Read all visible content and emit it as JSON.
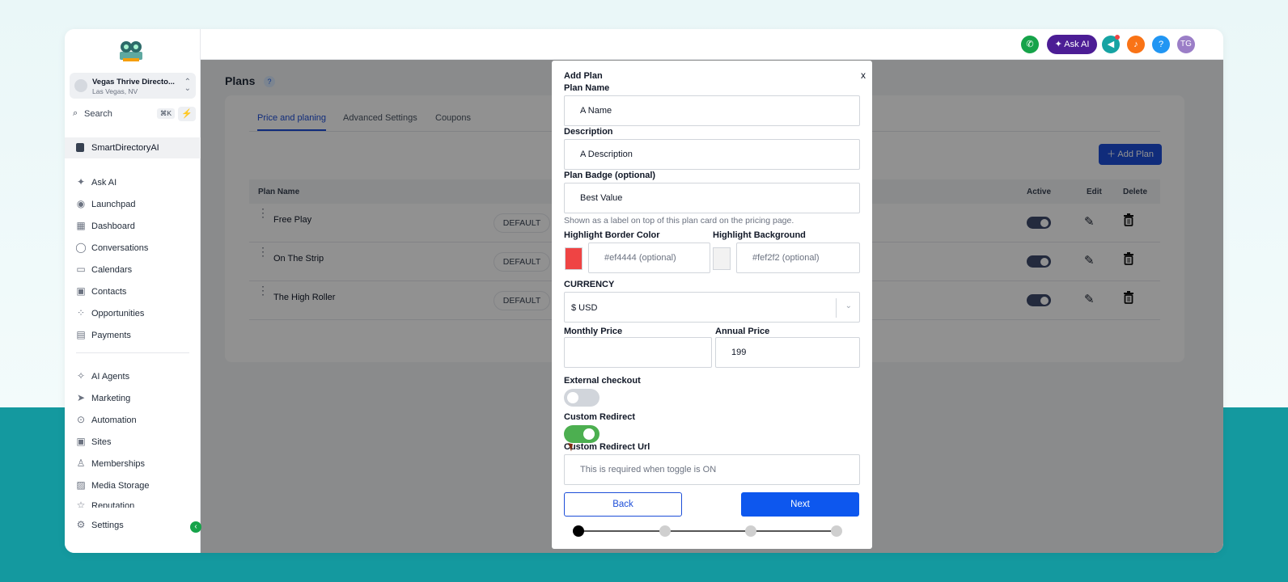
{
  "sidebar": {
    "location": {
      "name": "Vegas Thrive Directo...",
      "sub": "Las Vegas, NV"
    },
    "search": {
      "placeholder": "Search",
      "shortcut": "⌘K"
    },
    "account_label": "SmartDirectoryAI",
    "items": [
      {
        "label": "Ask AI",
        "icon": "sparkle-icon"
      },
      {
        "label": "Launchpad",
        "icon": "rocket-icon"
      },
      {
        "label": "Dashboard",
        "icon": "grid-icon"
      },
      {
        "label": "Conversations",
        "icon": "chat-icon"
      },
      {
        "label": "Calendars",
        "icon": "calendar-icon"
      },
      {
        "label": "Contacts",
        "icon": "contacts-icon"
      },
      {
        "label": "Opportunities",
        "icon": "pipeline-icon"
      },
      {
        "label": "Payments",
        "icon": "receipt-icon"
      }
    ],
    "items2": [
      {
        "label": "AI Agents",
        "icon": "ai-agent-icon"
      },
      {
        "label": "Marketing",
        "icon": "send-icon"
      },
      {
        "label": "Automation",
        "icon": "automation-icon"
      },
      {
        "label": "Sites",
        "icon": "sites-icon"
      },
      {
        "label": "Memberships",
        "icon": "badge-icon"
      },
      {
        "label": "Media Storage",
        "icon": "image-icon"
      },
      {
        "label": "Reputation",
        "icon": "star-icon"
      }
    ],
    "settings_label": "Settings"
  },
  "topbar": {
    "ask_ai": "Ask AI",
    "help": "?",
    "avatar": "TG"
  },
  "page": {
    "title": "Plans",
    "help": "?",
    "tabs": [
      "Price and planing",
      "Advanced Settings",
      "Coupons"
    ],
    "add_plan": "Add Plan",
    "columns": {
      "plan_name": "Plan Name",
      "active": "Active",
      "edit": "Edit",
      "delete": "Delete"
    },
    "rows": [
      {
        "name": "Free Play",
        "badge": "DEFAULT",
        "active": true
      },
      {
        "name": "On The Strip",
        "badge": "DEFAULT",
        "active": true
      },
      {
        "name": "The High Roller",
        "badge": "DEFAULT",
        "active": true
      }
    ]
  },
  "modal": {
    "title": "Add Plan",
    "close": "x",
    "plan_name_label": "Plan Name",
    "plan_name_value": "A Name",
    "description_label": "Description",
    "description_value": "A Description",
    "badge_label": "Plan Badge (optional)",
    "badge_value": "Best Value",
    "badge_help": "Shown as a label on top of this plan card on the pricing page.",
    "border_color_label": "Highlight Border Color",
    "border_color_placeholder": "#ef4444 (optional)",
    "bg_label": "Highlight Background",
    "bg_placeholder": "#fef2f2 (optional)",
    "currency_label": "CURRENCY",
    "currency_value": "$ USD",
    "monthly_label": "Monthly Price",
    "monthly_value": "",
    "annual_label": "Annual Price",
    "annual_value": "199",
    "external_checkout_label": "External checkout",
    "external_checkout_on": false,
    "custom_redirect_label": "Custom Redirect",
    "custom_redirect_on": true,
    "redirect_url_label": "Custom Redirect Url",
    "redirect_url_placeholder": "This is required when toggle is ON",
    "back": "Back",
    "next": "Next",
    "current_step": 1,
    "total_steps": 4
  },
  "colors": {
    "accent": "#1d4ed8",
    "next_button": "#0d57ee",
    "toggle_on": "#4caf50",
    "border_swatch": "#ef4444",
    "bg_swatch": "#f2f2f2",
    "teal_backdrop": "#14999f"
  }
}
